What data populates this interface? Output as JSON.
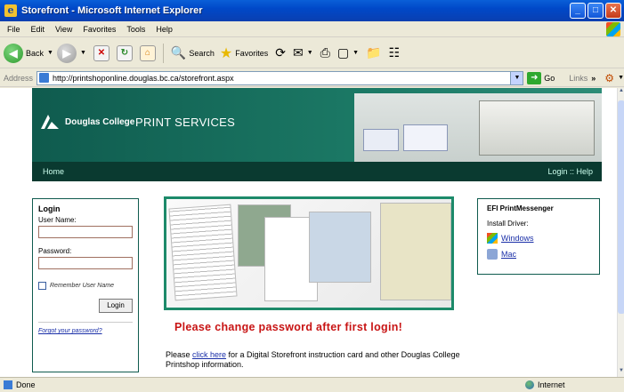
{
  "window": {
    "title": "Storefront - Microsoft Internet Explorer"
  },
  "menu": [
    "File",
    "Edit",
    "View",
    "Favorites",
    "Tools",
    "Help"
  ],
  "toolbar": {
    "back": "Back",
    "search": "Search",
    "favorites": "Favorites"
  },
  "address": {
    "label": "Address",
    "url": "http://printshoponline.douglas.bc.ca/storefront.aspx",
    "go": "Go",
    "links": "Links"
  },
  "banner": {
    "college": "Douglas College",
    "service": "PRINT SERVICES"
  },
  "nav": {
    "home": "Home",
    "right": "Login :: Help"
  },
  "login": {
    "heading": "Login",
    "username_label": "User Name:",
    "password_label": "Password:",
    "remember": "Remember User Name",
    "button": "Login",
    "forgot": "Forgot your password?"
  },
  "message": "Please change password after first login!",
  "info": {
    "pre": "Please ",
    "link": "click here",
    "post": " for a Digital Storefront instruction card and other Douglas College Printshop information."
  },
  "efi": {
    "heading": "EFI PrintMessenger",
    "install": "Install Driver:",
    "windows": "Windows",
    "mac": "Mac"
  },
  "status": {
    "left": "Done",
    "zone": "Internet"
  }
}
